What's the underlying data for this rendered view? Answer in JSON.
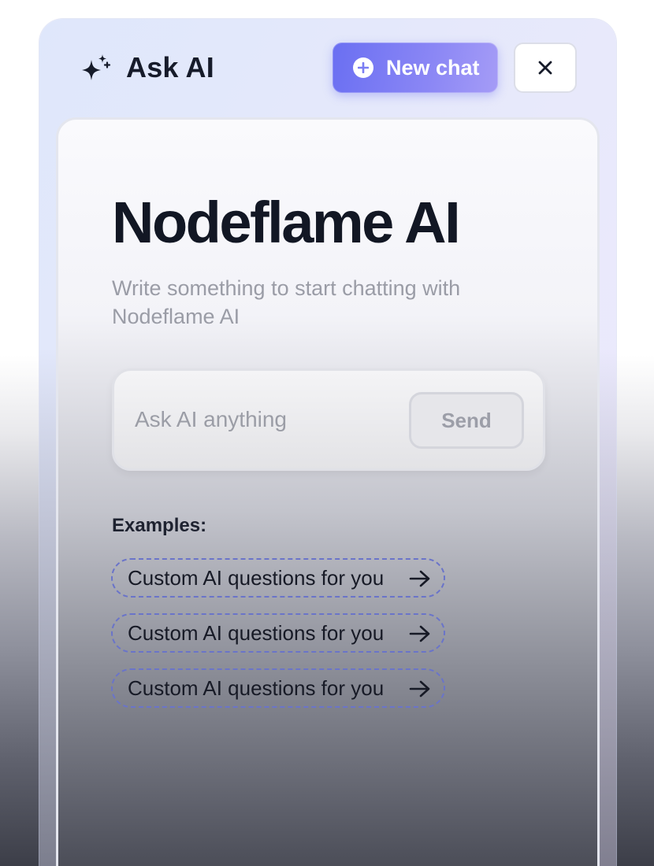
{
  "header": {
    "title": "Ask AI",
    "new_chat_label": "New chat",
    "icons": {
      "title": "sparkle-icon",
      "new_chat": "plus-circle-icon",
      "close": "close-icon"
    }
  },
  "main": {
    "heading": "Nodeflame AI",
    "subtitle": "Write something to start chatting with Nodeflame AI",
    "input": {
      "placeholder": "Ask AI anything",
      "value": ""
    },
    "send_label": "Send",
    "examples_label": "Examples:",
    "examples": [
      {
        "label": "Custom AI questions for you"
      },
      {
        "label": "Custom AI questions for you"
      },
      {
        "label": "Custom AI questions for you"
      }
    ]
  },
  "colors": {
    "accent": "#6a6ff2",
    "heading": "#121724",
    "muted_text": "#9a9ca6",
    "example_border": "#6a74c9"
  }
}
